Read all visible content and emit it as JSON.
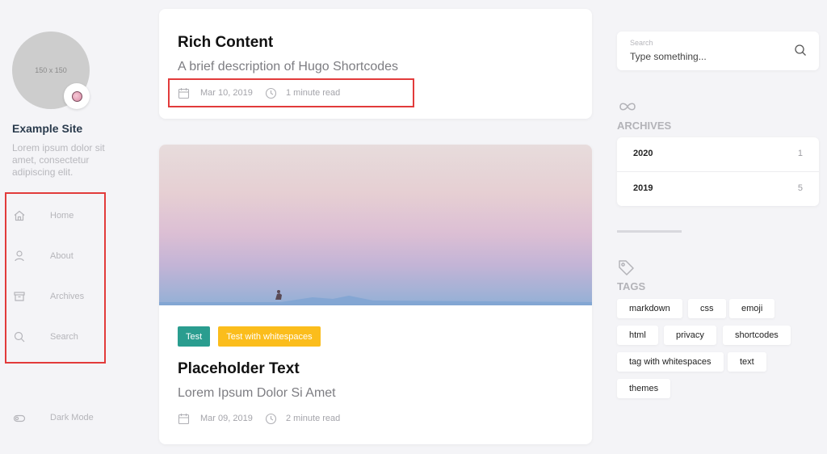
{
  "sidebar": {
    "avatar_text": "150 x 150",
    "site_title": "Example Site",
    "site_description": "Lorem ipsum dolor sit amet, consectetur adipiscing elit.",
    "nav": [
      {
        "label": "Home",
        "icon": "home-icon"
      },
      {
        "label": "About",
        "icon": "user-icon"
      },
      {
        "label": "Archives",
        "icon": "archive-icon"
      },
      {
        "label": "Search",
        "icon": "search-icon"
      }
    ],
    "dark_mode_label": "Dark Mode"
  },
  "posts": [
    {
      "title": "Rich Content",
      "description": "A brief description of Hugo Shortcodes",
      "date": "Mar 10, 2019",
      "read_time": "1 minute read"
    },
    {
      "tags": [
        {
          "label": "Test",
          "color": "#2a9d8f"
        },
        {
          "label": "Test with whitespaces",
          "color": "#fbbd1c"
        }
      ],
      "title": "Placeholder Text",
      "description": "Lorem Ipsum Dolor Si Amet",
      "date": "Mar 09, 2019",
      "read_time": "2 minute read"
    }
  ],
  "search_widget": {
    "label": "Search",
    "placeholder": "Type something..."
  },
  "archives_widget": {
    "title": "ARCHIVES",
    "years": [
      {
        "year": "2020",
        "count": "1"
      },
      {
        "year": "2019",
        "count": "5"
      }
    ]
  },
  "tags_widget": {
    "title": "TAGS",
    "tags": [
      "markdown",
      "css",
      "emoji",
      "html",
      "privacy",
      "shortcodes",
      "tag with whitespaces",
      "text",
      "themes"
    ]
  },
  "colors": {
    "background": "#f4f4f7",
    "highlight_border": "#e23b3b",
    "tag_teal": "#2a9d8f",
    "tag_yellow": "#fbbd1c"
  }
}
